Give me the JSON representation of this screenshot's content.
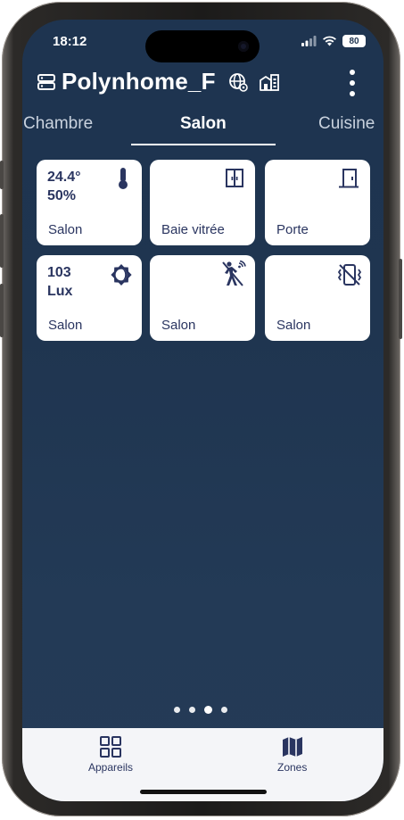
{
  "status_bar": {
    "time": "18:12",
    "battery": "80",
    "icons": [
      "signal-icon",
      "wifi-icon",
      "battery-icon"
    ]
  },
  "header": {
    "title": "Polynhome_F",
    "icons": [
      "server-icon",
      "globe-settings-icon",
      "building-icon",
      "more-vertical-icon"
    ]
  },
  "tabs": [
    {
      "label": "Chambre",
      "active": false
    },
    {
      "label": "Salon",
      "active": true
    },
    {
      "label": "Cuisine",
      "active": false
    }
  ],
  "tiles": [
    {
      "value": "24.4°",
      "value2": "50%",
      "label": "Salon",
      "icon": "thermometer-icon"
    },
    {
      "value": "",
      "value2": "",
      "label": "Baie vitrée",
      "icon": "double-door-icon"
    },
    {
      "value": "",
      "value2": "",
      "label": "Porte",
      "icon": "door-icon"
    },
    {
      "value": "103",
      "value2": "Lux",
      "label": "Salon",
      "icon": "brightness-icon"
    },
    {
      "value": "",
      "value2": "",
      "label": "Salon",
      "icon": "motion-sensor-icon"
    },
    {
      "value": "",
      "value2": "",
      "label": "Salon",
      "icon": "vibration-off-icon"
    }
  ],
  "pager": {
    "count": 4,
    "active_index": 2
  },
  "bottom_nav": [
    {
      "label": "Appareils",
      "icon": "grid-icon"
    },
    {
      "label": "Zones",
      "icon": "map-icon"
    }
  ],
  "colors": {
    "background": "#1e3450",
    "tile": "#ffffff",
    "tile_text": "#2a3560",
    "tabbar": "#f4f5f8"
  }
}
